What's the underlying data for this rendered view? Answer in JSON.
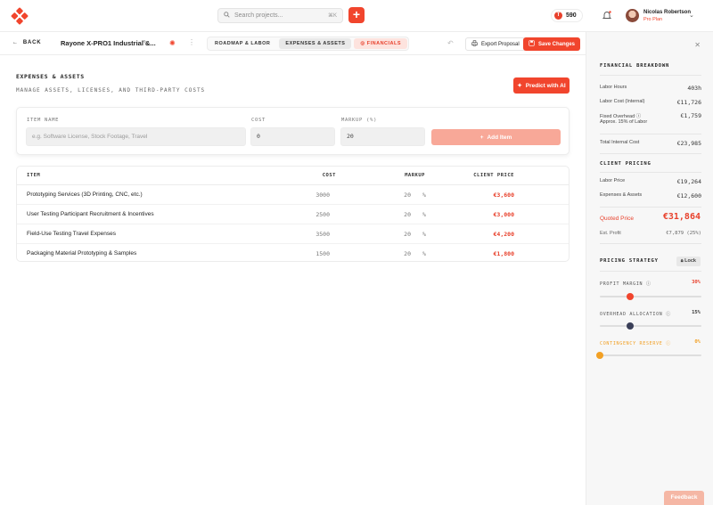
{
  "colors": {
    "accent": "#f1452d",
    "accent_light": "#f8a898",
    "overhead_knob": "#3a3f58",
    "contingency": "#f2a024"
  },
  "topbar": {
    "search_placeholder": "Search projects...",
    "search_shortcut": "⌘K",
    "add_label": "+",
    "credits": "590",
    "user_name": "Nicolas Robertson",
    "user_plan": "Pro Plan"
  },
  "subbar": {
    "back_label": "BACK",
    "project_title": "Rayone X-PRO1 Industrial &...",
    "tabs": [
      "ROADMAP & LABOR",
      "EXPENSES & ASSETS",
      "FINANCIALS"
    ],
    "export_label": "Export Proposal",
    "save_label": "Save Changes"
  },
  "main": {
    "title": "EXPENSES & ASSETS",
    "subtitle": "MANAGE ASSETS, LICENSES, AND THIRD-PARTY COSTS",
    "predict_label": "Predict with AI",
    "form": {
      "item_label": "ITEM NAME",
      "item_placeholder": "e.g. Software License, Stock Footage, Travel",
      "cost_label": "COST",
      "cost_value": "0",
      "markup_label": "MARKUP (%)",
      "markup_value": "20",
      "add_label": "Add Item"
    },
    "table": {
      "headers": [
        "ITEM",
        "COST",
        "MARKUP",
        "CLIENT PRICE"
      ],
      "rows": [
        {
          "item": "Prototyping Services (3D Printing, CNC, etc.)",
          "cost": "3000",
          "markup": "20",
          "pct": "%",
          "price": "€3,600"
        },
        {
          "item": "User Testing Participant Recruitment & Incentives",
          "cost": "2500",
          "markup": "20",
          "pct": "%",
          "price": "€3,000"
        },
        {
          "item": "Field-Use Testing Travel Expenses",
          "cost": "3500",
          "markup": "20",
          "pct": "%",
          "price": "€4,200"
        },
        {
          "item": "Packaging Material Prototyping & Samples",
          "cost": "1500",
          "markup": "20",
          "pct": "%",
          "price": "€1,800"
        }
      ]
    }
  },
  "panel": {
    "breakdown_title": "FINANCIAL BREAKDOWN",
    "labor_hours_label": "Labor Hours",
    "labor_hours_value": "403h",
    "labor_cost_label": "Labor Cost (Internal)",
    "labor_cost_value": "€11,726",
    "fixed_overhead_label": "Fixed Overhead",
    "fixed_overhead_note": "Approx. 15% of Labor",
    "fixed_overhead_value": "€1,759",
    "total_internal_label": "Total Internal Cost",
    "total_internal_value": "€23,985",
    "client_title": "CLIENT PRICING",
    "labor_price_label": "Labor Price",
    "labor_price_value": "€19,264",
    "expenses_label": "Expenses & Assets",
    "expenses_value": "€12,600",
    "quoted_label": "Quoted Price",
    "quoted_value": "€31,864",
    "profit_label": "Est. Profit",
    "profit_value": "€7,879 (25%)",
    "strategy_title": "PRICING STRATEGY",
    "lock_label": "Lock",
    "sliders": [
      {
        "label": "PROFIT MARGIN",
        "pct": "30%",
        "level": 0.3
      },
      {
        "label": "OVERHEAD ALLOCATION",
        "pct": "15%",
        "level": 0.3
      },
      {
        "label": "CONTINGENCY RESERVE",
        "pct": "0%",
        "level": 0.0
      }
    ]
  },
  "feedback_label": "Feedback"
}
